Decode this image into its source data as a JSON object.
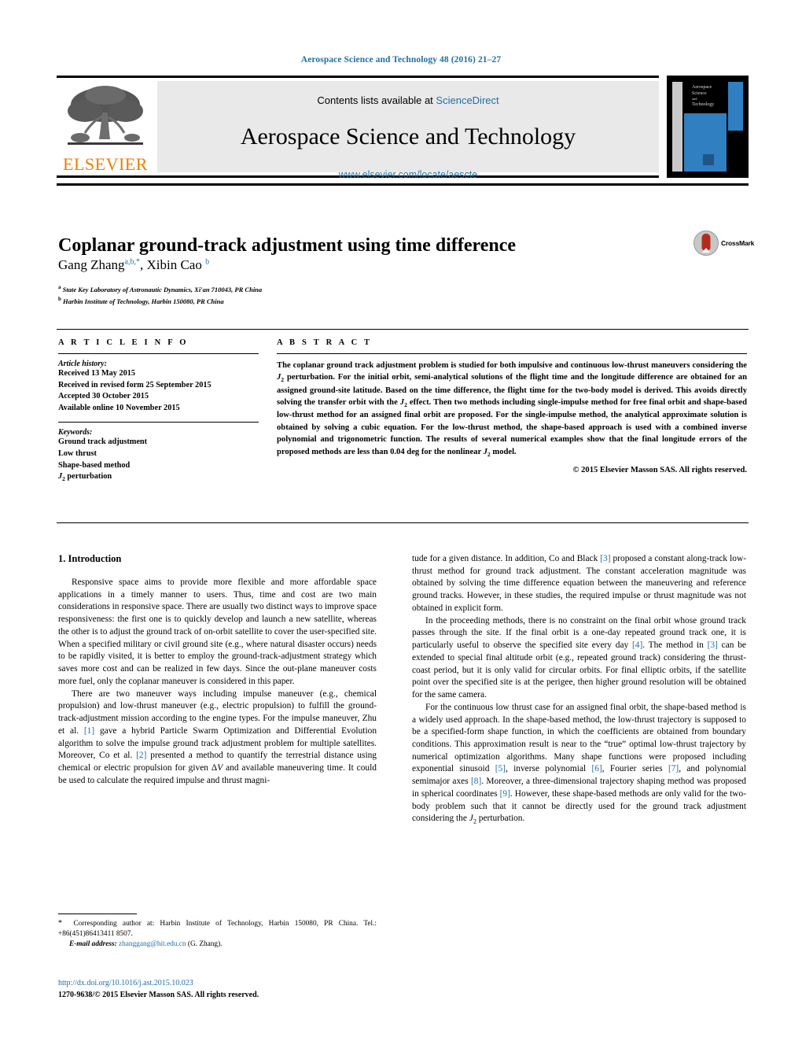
{
  "journal_ref": "Aerospace Science and Technology 48 (2016) 21–27",
  "masthead": {
    "contents_label": "Contents lists available at",
    "sciencedirect": "ScienceDirect",
    "journal_title": "Aerospace Science and Technology",
    "journal_url": "www.elsevier.com/locate/aescte",
    "publisher_wordmark": "ELSEVIER",
    "cover_title_lines": [
      "Aerospace",
      "Science",
      "and",
      "Technology"
    ]
  },
  "article": {
    "title": "Coplanar ground-track adjustment using time difference",
    "authors_html": "Gang Zhang<sup>a,b,<span class=\"star\">*</span></sup>, Xibin Cao <sup>b</sup>",
    "affiliations": [
      {
        "marker": "a",
        "text": "State Key Laboratory of Astronautic Dynamics, Xi'an 710043, PR China"
      },
      {
        "marker": "b",
        "text": "Harbin Institute of Technology, Harbin 150080, PR China"
      }
    ],
    "crossmark_label": "CrossMark"
  },
  "info": {
    "heading": "A R T I C L E   I N F O",
    "history_label": "Article history:",
    "history": [
      "Received 13 May 2015",
      "Received in revised form 25 September 2015",
      "Accepted 30 October 2015",
      "Available online 10 November 2015"
    ],
    "keywords_label": "Keywords:",
    "keywords_html": "Ground track adjustment<br>Low thrust<br>Shape-based method<br><i>J</i><sub>2</sub> perturbation"
  },
  "abstract": {
    "heading": "A B S T R A C T",
    "text_html": "The coplanar ground track adjustment problem is studied for both impulsive and continuous low-thrust maneuvers considering the <i>J</i><sub>2</sub> perturbation. For the initial orbit, semi-analytical solutions of the flight time and the longitude difference are obtained for an assigned ground-site latitude. Based on the time difference, the flight time for the two-body model is derived. This avoids directly solving the transfer orbit with the <i>J</i><sub>2</sub> effect. Then two methods including single-impulse method for free final orbit and shape-based low-thrust method for an assigned final orbit are proposed. For the single-impulse method, the analytical approximate solution is obtained by solving a cubic equation. For the low-thrust method, the shape-based approach is used with a combined inverse polynomial and trigonometric function. The results of several numerical examples show that the final longitude errors of the proposed methods are less than 0.04 deg for the nonlinear <i>J</i><sub>2</sub> model.",
    "copyright": "© 2015 Elsevier Masson SAS. All rights reserved."
  },
  "body": {
    "section_title": "1. Introduction",
    "left_paragraphs_html": [
      "Responsive space aims to provide more flexible and more affordable space applications in a timely manner to users. Thus, time and cost are two main considerations in responsive space. There are usually two distinct ways to improve space responsiveness: the first one is to quickly develop and launch a new satellite, whereas the other is to adjust the ground track of on-orbit satellite to cover the user-specified site. When a specified military or civil ground site (e.g., where natural disaster occurs) needs to be rapidly visited, it is better to employ the ground-track-adjustment strategy which saves more cost and can be realized in few days. Since the out-plane maneuver costs more fuel, only the coplanar maneuver is considered in this paper.",
      "There are two maneuver ways including impulse maneuver (e.g., chemical propulsion) and low-thrust maneuver (e.g., electric propulsion) to fulfill the ground-track-adjustment mission according to the engine types. For the impulse maneuver, Zhu et al. <span class=\"ref\">[1]</span> gave a hybrid Particle Swarm Optimization and Differential Evolution algorithm to solve the impulse ground track adjustment problem for multiple satellites. Moreover, Co et al. <span class=\"ref\">[2]</span> presented a method to quantify the terrestrial distance using chemical or electric propulsion for given &Delta;<i>V</i> and available maneuvering time. It could be used to calculate the required impulse and thrust magni-"
    ],
    "right_paragraphs_html": [
      "tude for a given distance. In addition, Co and Black <span class=\"ref\">[3]</span> proposed a constant along-track low-thrust method for ground track adjustment. The constant acceleration magnitude was obtained by solving the time difference equation between the maneuvering and reference ground tracks. However, in these studies, the required impulse or thrust magnitude was not obtained in explicit form.",
      "In the proceeding methods, there is no constraint on the final orbit whose ground track passes through the site. If the final orbit is a one-day repeated ground track one, it is particularly useful to observe the specified site every day <span class=\"ref\">[4]</span>. The method in <span class=\"ref\">[3]</span> can be extended to special final altitude orbit (e.g., repeated ground track) considering the thrust-coast period, but it is only valid for circular orbits. For final elliptic orbits, if the satellite point over the specified site is at the perigee, then higher ground resolution will be obtained for the same camera.",
      "For the continuous low thrust case for an assigned final orbit, the shape-based method is a widely used approach. In the shape-based method, the low-thrust trajectory is supposed to be a specified-form shape function, in which the coefficients are obtained from boundary conditions. This approximation result is near to the &ldquo;true&rdquo; optimal low-thrust trajectory by numerical optimization algorithms. Many shape functions were proposed including exponential sinusoid <span class=\"ref\">[5]</span>, inverse polynomial <span class=\"ref\">[6]</span>, Fourier series <span class=\"ref\">[7]</span>, and polynomial semimajor axes <span class=\"ref\">[8]</span>. Moreover, a three-dimensional trajectory shaping method was proposed in spherical coordinates <span class=\"ref\">[9]</span>. However, these shape-based methods are only valid for the two-body problem such that it cannot be directly used for the ground track adjustment considering the <i>J</i><sub>2</sub> perturbation."
    ]
  },
  "footnote": {
    "corresponding_html": "<span class=\"star\">*</span> &nbsp;Corresponding author at: Harbin Institute of Technology, Harbin 150080, PR China. Tel.: +86(451)86413411 8507.",
    "email_label": "E-mail address:",
    "email": "zhanggang@hit.edu.cn",
    "email_suffix": "(G. Zhang)."
  },
  "footer": {
    "doi": "http://dx.doi.org/10.1016/j.ast.2015.10.023",
    "issn_line": "1270-9638/© 2015 Elsevier Masson SAS. All rights reserved."
  },
  "colors": {
    "link_blue": "#1f6fa8",
    "elsevier_orange": "#f07c00",
    "cover_blue": "#2f7fc1",
    "crossmark_red": "#b52b1b"
  }
}
